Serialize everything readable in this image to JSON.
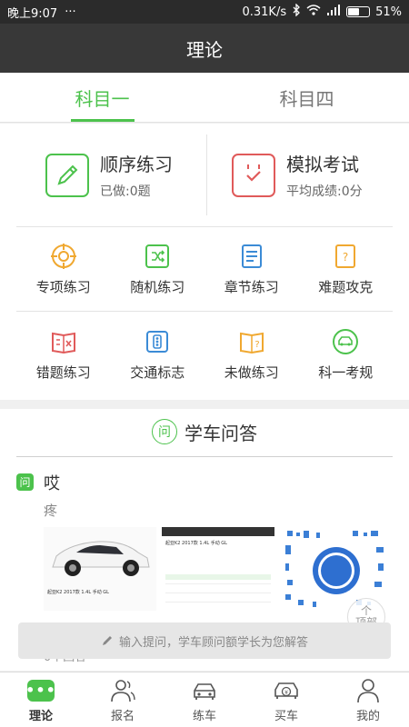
{
  "status_bar": {
    "time": "晚上9:07",
    "dots": "···",
    "speed": "0.31K/s",
    "battery_percent": "51%",
    "battery_level": 0.51
  },
  "nav": {
    "title": "理论"
  },
  "tabs": [
    {
      "label": "科目一",
      "active": true
    },
    {
      "label": "科目四",
      "active": false
    }
  ],
  "practice": {
    "sequential": {
      "title": "顺序练习",
      "sub": "已做:0题"
    },
    "mock": {
      "title": "模拟考试",
      "sub": "平均成绩:0分"
    }
  },
  "grid": [
    {
      "label": "专项练习",
      "icon": "target-icon",
      "color": "#f0a830"
    },
    {
      "label": "随机练习",
      "icon": "shuffle-icon",
      "color": "#4cc24c"
    },
    {
      "label": "章节练习",
      "icon": "notebook-icon",
      "color": "#3b8bd6"
    },
    {
      "label": "难题攻克",
      "icon": "question-doc-icon",
      "color": "#f0a830"
    },
    {
      "label": "错题练习",
      "icon": "wrong-book-icon",
      "color": "#e05a5a"
    },
    {
      "label": "交通标志",
      "icon": "traffic-light-icon",
      "color": "#3b8bd6"
    },
    {
      "label": "未做练习",
      "icon": "question-book-icon",
      "color": "#f0a830"
    },
    {
      "label": "科一考规",
      "icon": "car-icon",
      "color": "#4cc24c"
    }
  ],
  "qa": {
    "title": "学车问答",
    "header_icon": "问",
    "badge": "问",
    "question_title": "哎",
    "question_body": "疼",
    "thumbs": [
      {
        "caption": "起亚K2 2017款 1.4L 手动 GL"
      },
      {
        "caption": "起亚K2 2017款 1.4L 手动 GL"
      },
      {
        "caption": ""
      }
    ],
    "footer": "0个回答"
  },
  "top_button": {
    "line1": "个",
    "line2": "顶部"
  },
  "ask_bar": {
    "placeholder": "输入提问，学车顾问额学长为您解答"
  },
  "bottom_nav": [
    {
      "label": "理论",
      "icon": "chat-dots-icon",
      "active": true
    },
    {
      "label": "报名",
      "icon": "people-icon",
      "active": false
    },
    {
      "label": "练车",
      "icon": "car-front-icon",
      "active": false
    },
    {
      "label": "买车",
      "icon": "car-yen-icon",
      "active": false
    },
    {
      "label": "我的",
      "icon": "person-icon",
      "active": false
    }
  ],
  "colors": {
    "green": "#4cc24c",
    "red": "#e05a5a",
    "dark": "#383838"
  }
}
